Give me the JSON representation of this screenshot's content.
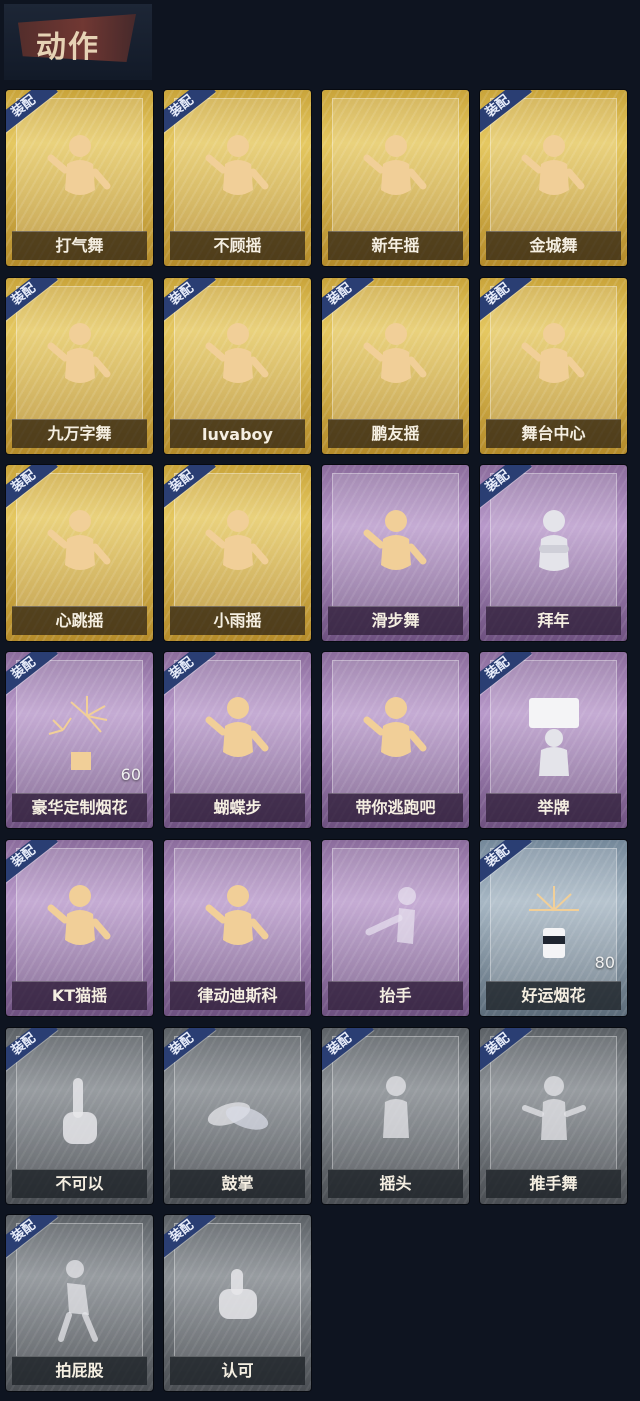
{
  "header": {
    "title": "动作"
  },
  "equip_label": "装配",
  "cards": [
    {
      "label": "打气舞",
      "tier": "gold",
      "equipped": true,
      "count": "",
      "icon": "dance-figure-icon"
    },
    {
      "label": "不顾摇",
      "tier": "gold",
      "equipped": true,
      "count": "",
      "icon": "dance-figure-icon"
    },
    {
      "label": "新年摇",
      "tier": "gold",
      "equipped": false,
      "count": "",
      "icon": "dance-figure-icon"
    },
    {
      "label": "金城舞",
      "tier": "gold",
      "equipped": true,
      "count": "",
      "icon": "dance-figure-icon"
    },
    {
      "label": "九万字舞",
      "tier": "gold",
      "equipped": true,
      "count": "",
      "icon": "dance-figure-icon"
    },
    {
      "label": "luvaboy",
      "tier": "gold",
      "equipped": true,
      "count": "",
      "icon": "dance-figure-icon"
    },
    {
      "label": "鹏友摇",
      "tier": "gold",
      "equipped": true,
      "count": "",
      "icon": "dance-figure-icon"
    },
    {
      "label": "舞台中心",
      "tier": "gold",
      "equipped": true,
      "count": "",
      "icon": "dance-figure-icon"
    },
    {
      "label": "心跳摇",
      "tier": "gold",
      "equipped": true,
      "count": "",
      "icon": "dance-figure-icon"
    },
    {
      "label": "小雨摇",
      "tier": "gold",
      "equipped": true,
      "count": "",
      "icon": "dance-figure-icon"
    },
    {
      "label": "滑步舞",
      "tier": "purple",
      "equipped": false,
      "count": "",
      "icon": "dance-figure-icon"
    },
    {
      "label": "拜年",
      "tier": "purple",
      "equipped": true,
      "count": "",
      "icon": "bow-figure-icon"
    },
    {
      "label": "豪华定制烟花",
      "tier": "purple",
      "equipped": true,
      "count": "60",
      "icon": "fireworks-icon"
    },
    {
      "label": "蝴蝶步",
      "tier": "purple",
      "equipped": true,
      "count": "",
      "icon": "dance-figure-icon"
    },
    {
      "label": "带你逃跑吧",
      "tier": "purple",
      "equipped": false,
      "count": "",
      "icon": "dance-figure-icon"
    },
    {
      "label": "举牌",
      "tier": "purple",
      "equipped": true,
      "count": "",
      "icon": "sign-figure-icon"
    },
    {
      "label": "KT猫摇",
      "tier": "purple",
      "equipped": true,
      "count": "",
      "icon": "dance-figure-icon"
    },
    {
      "label": "律动迪斯科",
      "tier": "purple",
      "equipped": false,
      "count": "",
      "icon": "dance-figure-icon"
    },
    {
      "label": "抬手",
      "tier": "purple",
      "equipped": false,
      "count": "",
      "icon": "raise-hand-figure-icon"
    },
    {
      "label": "好运烟花",
      "tier": "blue",
      "equipped": true,
      "count": "80",
      "icon": "firework-can-icon"
    },
    {
      "label": "不可以",
      "tier": "gray",
      "equipped": true,
      "count": "",
      "icon": "finger-wag-icon"
    },
    {
      "label": "鼓掌",
      "tier": "gray",
      "equipped": true,
      "count": "",
      "icon": "clap-hands-icon"
    },
    {
      "label": "摇头",
      "tier": "gray",
      "equipped": true,
      "count": "",
      "icon": "shake-head-figure-icon"
    },
    {
      "label": "推手舞",
      "tier": "gray",
      "equipped": true,
      "count": "",
      "icon": "push-hands-figure-icon"
    },
    {
      "label": "拍屁股",
      "tier": "gray",
      "equipped": true,
      "count": "",
      "icon": "pat-figure-icon"
    },
    {
      "label": "认可",
      "tier": "gray",
      "equipped": true,
      "count": "",
      "icon": "thumbs-up-icon"
    }
  ]
}
